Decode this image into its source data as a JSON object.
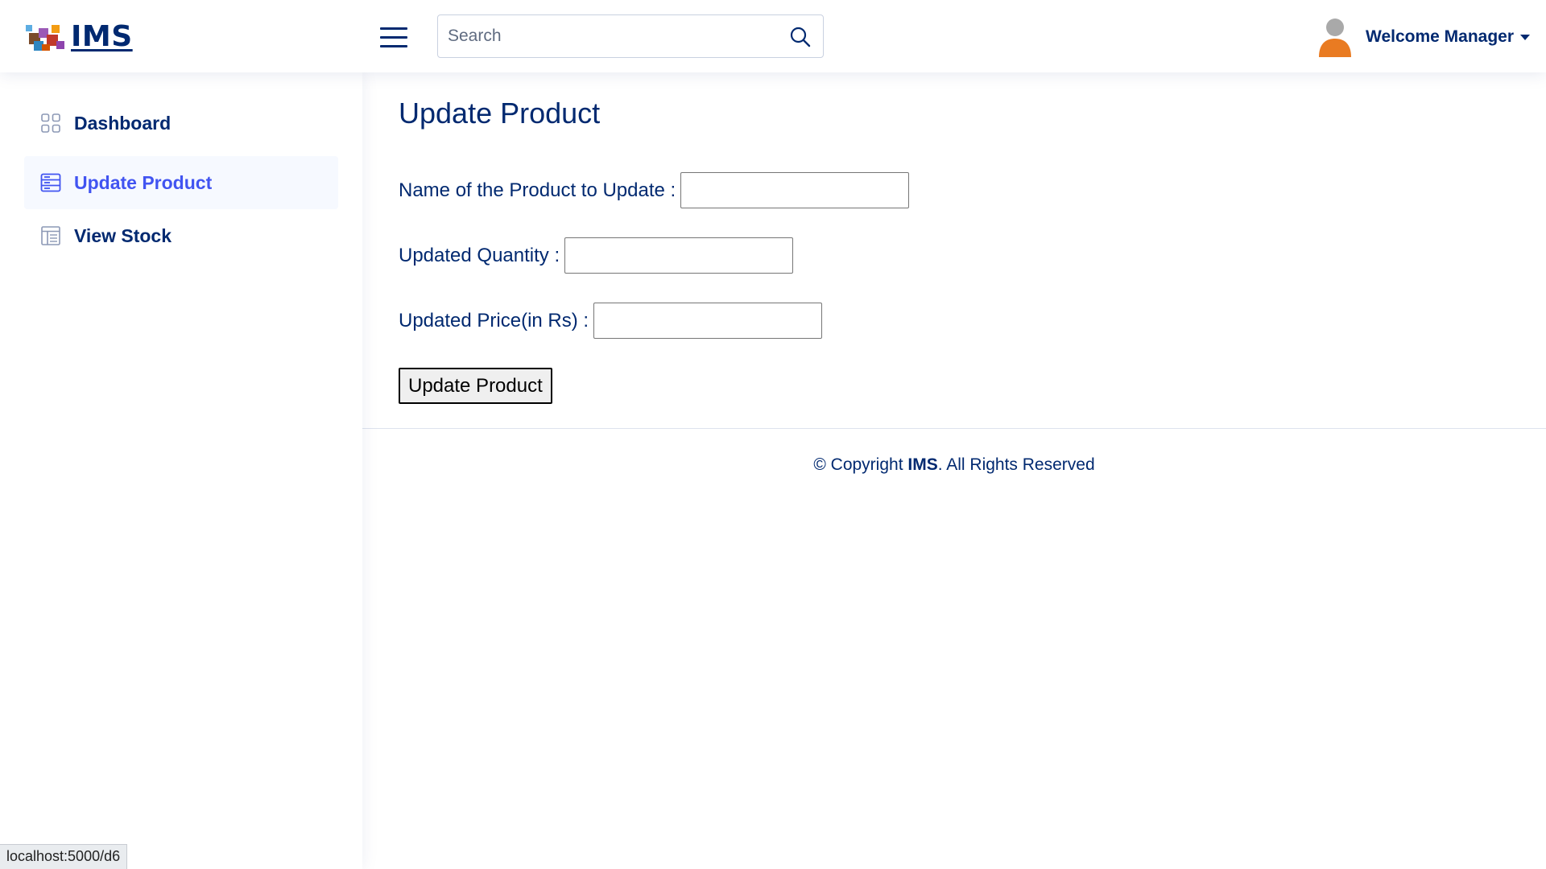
{
  "header": {
    "logo_text": "IMS",
    "logo_icon": "warehouse-boxes-logo",
    "menu_icon": "hamburger-icon",
    "search": {
      "placeholder": "Search",
      "value": "",
      "icon": "search-icon"
    },
    "user": {
      "avatar_icon": "user-avatar-icon",
      "welcome_text": "Welcome Manager"
    }
  },
  "sidebar": {
    "items": [
      {
        "label": "Dashboard",
        "icon": "grid-icon",
        "active": false
      },
      {
        "label": "Update Product",
        "icon": "layout-list-icon",
        "active": true
      },
      {
        "label": "View Stock",
        "icon": "table-icon",
        "active": false
      }
    ]
  },
  "main": {
    "title": "Update Product",
    "form": {
      "product_name_label": "Name of the Product to Update :",
      "product_name_value": "",
      "quantity_label": "Updated Quantity :",
      "quantity_value": "",
      "price_label": "Updated Price(in Rs) :",
      "price_value": "",
      "submit_label": "Update Product"
    },
    "footer": {
      "prefix": "© Copyright ",
      "brand": "IMS",
      "suffix": ". All Rights Reserved"
    }
  },
  "status_bar": {
    "url": "localhost:5000/d6"
  },
  "colors": {
    "primary_text": "#012970",
    "accent": "#4154f1",
    "avatar_body": "#e97b22",
    "avatar_head": "#a9a9a9"
  }
}
